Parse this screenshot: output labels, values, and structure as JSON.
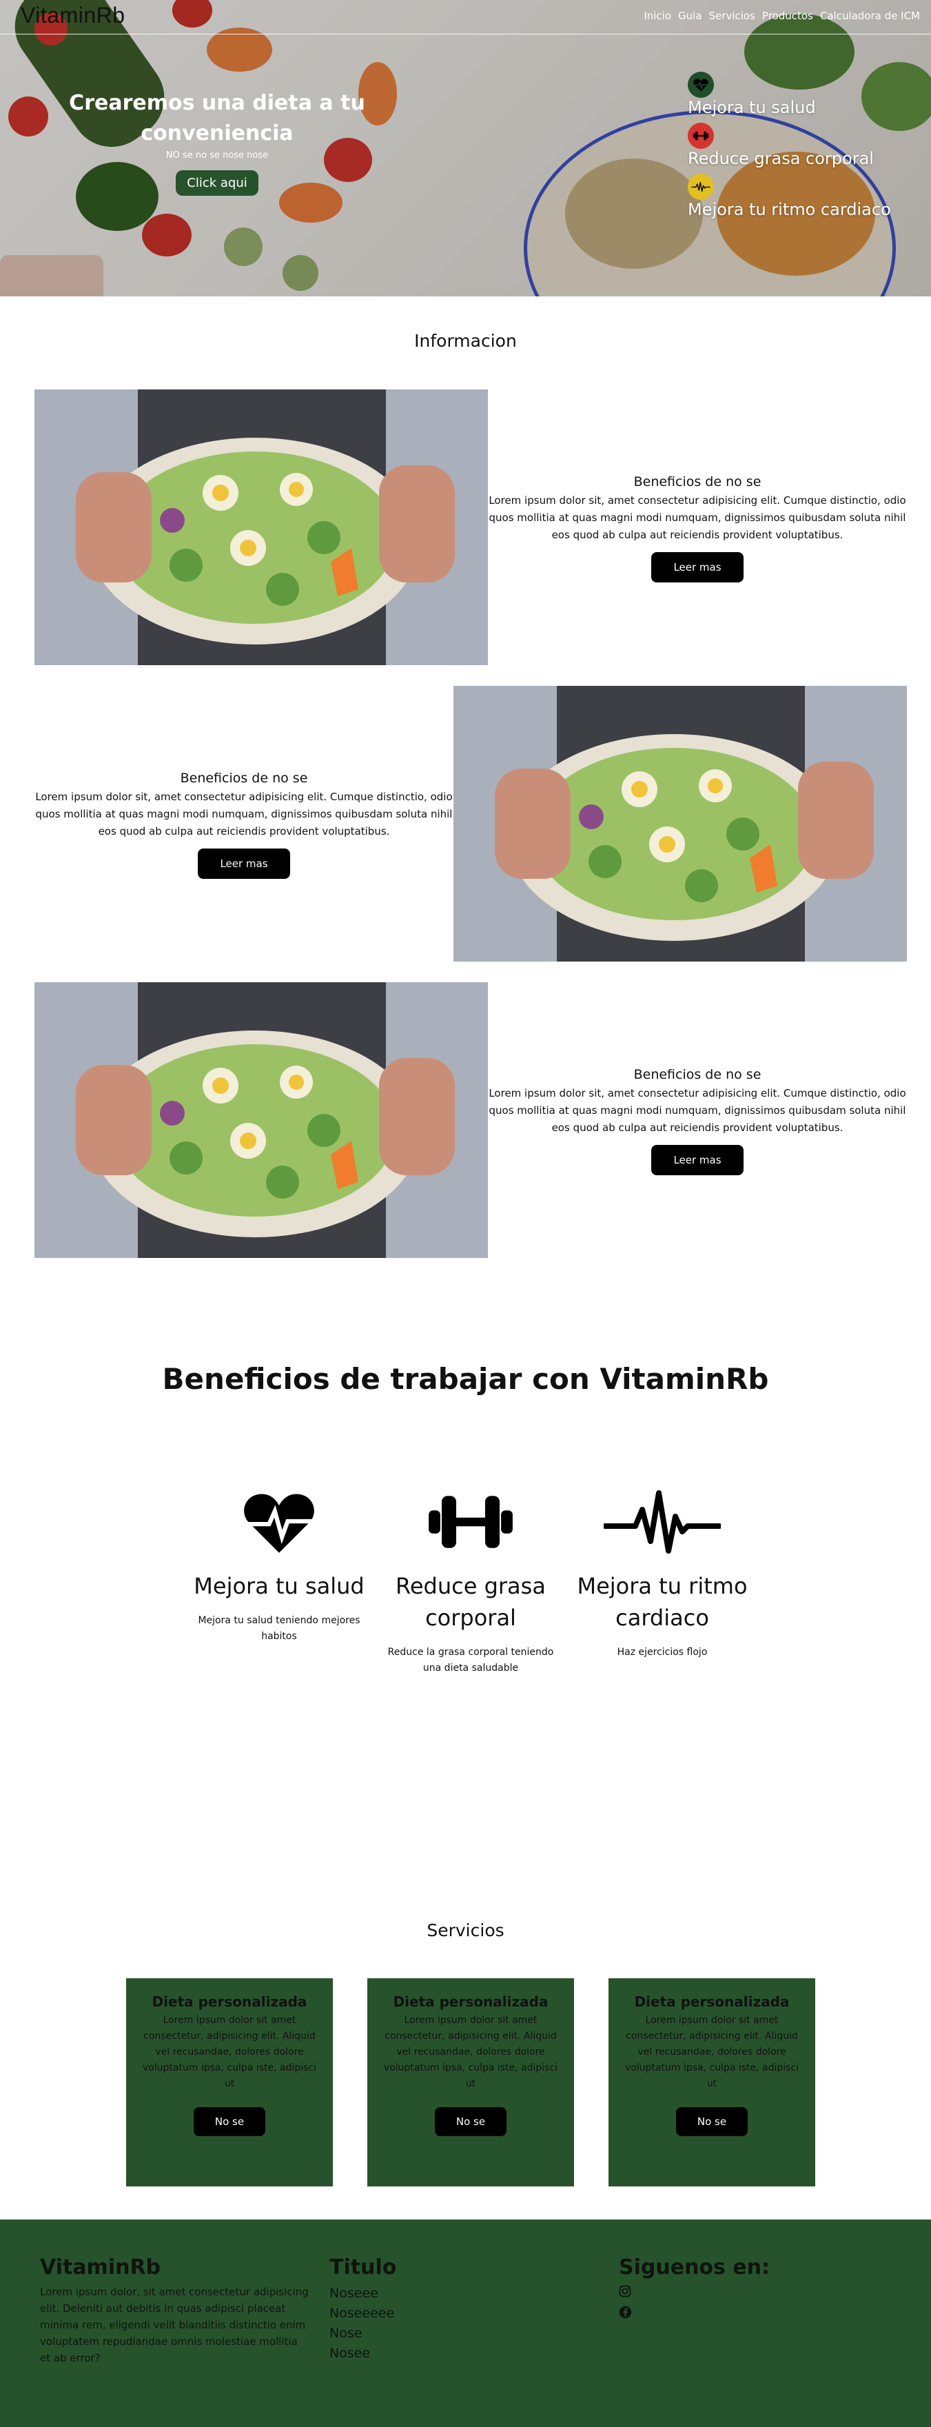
{
  "brand": "VitaminRb",
  "nav": {
    "items": [
      "Inicio",
      "Guia",
      "Servicios",
      "Productos",
      "Calculadora de ICM"
    ]
  },
  "hero": {
    "title": "Crearemos una dieta a tu conveniencia",
    "subtitle": "NO se no se nose nose",
    "cta": "Click aqui",
    "highlights": [
      {
        "icon": "heart-pulse-icon",
        "label": "Mejora tu salud",
        "color": "#1f4f2a"
      },
      {
        "icon": "dumbbell-icon",
        "label": "Reduce grasa corporal",
        "color": "#d6342f"
      },
      {
        "icon": "heartbeat-icon",
        "label": "Mejora tu ritmo cardiaco",
        "color": "#e3c022"
      }
    ]
  },
  "info": {
    "title": "Informacion",
    "items": [
      {
        "title": "Beneficios de no se",
        "body": "Lorem ipsum dolor sit, amet consectetur adipisicing elit. Cumque distinctio, odio quos mollitia at quas magni modi numquam, dignissimos quibusdam soluta nihil eos quod ab culpa aut reiciendis provident voluptatibus.",
        "button": "Leer mas"
      },
      {
        "title": "Beneficios de no se",
        "body": "Lorem ipsum dolor sit, amet consectetur adipisicing elit. Cumque distinctio, odio quos mollitia at quas magni modi numquam, dignissimos quibusdam soluta nihil eos quod ab culpa aut reiciendis provident voluptatibus.",
        "button": "Leer mas"
      },
      {
        "title": "Beneficios de no se",
        "body": "Lorem ipsum dolor sit, amet consectetur adipisicing elit. Cumque distinctio, odio quos mollitia at quas magni modi numquam, dignissimos quibusdam soluta nihil eos quod ab culpa aut reiciendis provident voluptatibus.",
        "button": "Leer mas"
      }
    ]
  },
  "benefits": {
    "title": "Beneficios de trabajar con VitaminRb",
    "items": [
      {
        "icon": "heart-pulse-icon",
        "name": "Mejora tu salud",
        "desc": "Mejora tu salud teniendo mejores habitos"
      },
      {
        "icon": "dumbbell-icon",
        "name": "Reduce grasa corporal",
        "desc": "Reduce la grasa corporal teniendo una dieta saludable"
      },
      {
        "icon": "heartbeat-icon",
        "name": "Mejora tu ritmo cardiaco",
        "desc": "Haz ejercicios flojo"
      }
    ]
  },
  "services": {
    "title": "Servicios",
    "items": [
      {
        "title": "Dieta personalizada",
        "body": "Lorem ipsum dolor sit amet consectetur, adipisicing elit. Aliquid vel recusandae, dolores dolore voluptatum ipsa, culpa iste, adipisci ut",
        "button": "No se"
      },
      {
        "title": "Dieta personalizada",
        "body": "Lorem ipsum dolor sit amet consectetur, adipisicing elit. Aliquid vel recusandae, dolores dolore voluptatum ipsa, culpa iste, adipisci ut",
        "button": "No se"
      },
      {
        "title": "Dieta personalizada",
        "body": "Lorem ipsum dolor sit amet consectetur, adipisicing elit. Aliquid vel recusandae, dolores dolore voluptatum ipsa, culpa iste, adipisci ut",
        "button": "No se"
      }
    ]
  },
  "footer": {
    "brand": "VitaminRb",
    "about": "Lorem ipsum dolor, sit amet consectetur adipisicing elit. Deleniti aut debitis in quas adipisci placeat minima rem, eligendi velit blanditiis distinctio enim voluptatem repudiandae omnis molestiae mollitia et ab error?",
    "links_title": "Titulo",
    "links": [
      "Noseee",
      "Noseeeee",
      "Nose",
      "Nosee"
    ],
    "social_title": "Siguenos en:",
    "social": [
      {
        "icon": "instagram-icon"
      },
      {
        "icon": "facebook-icon"
      }
    ]
  },
  "colors": {
    "brand_green": "#27532c",
    "button_black": "#000000"
  }
}
